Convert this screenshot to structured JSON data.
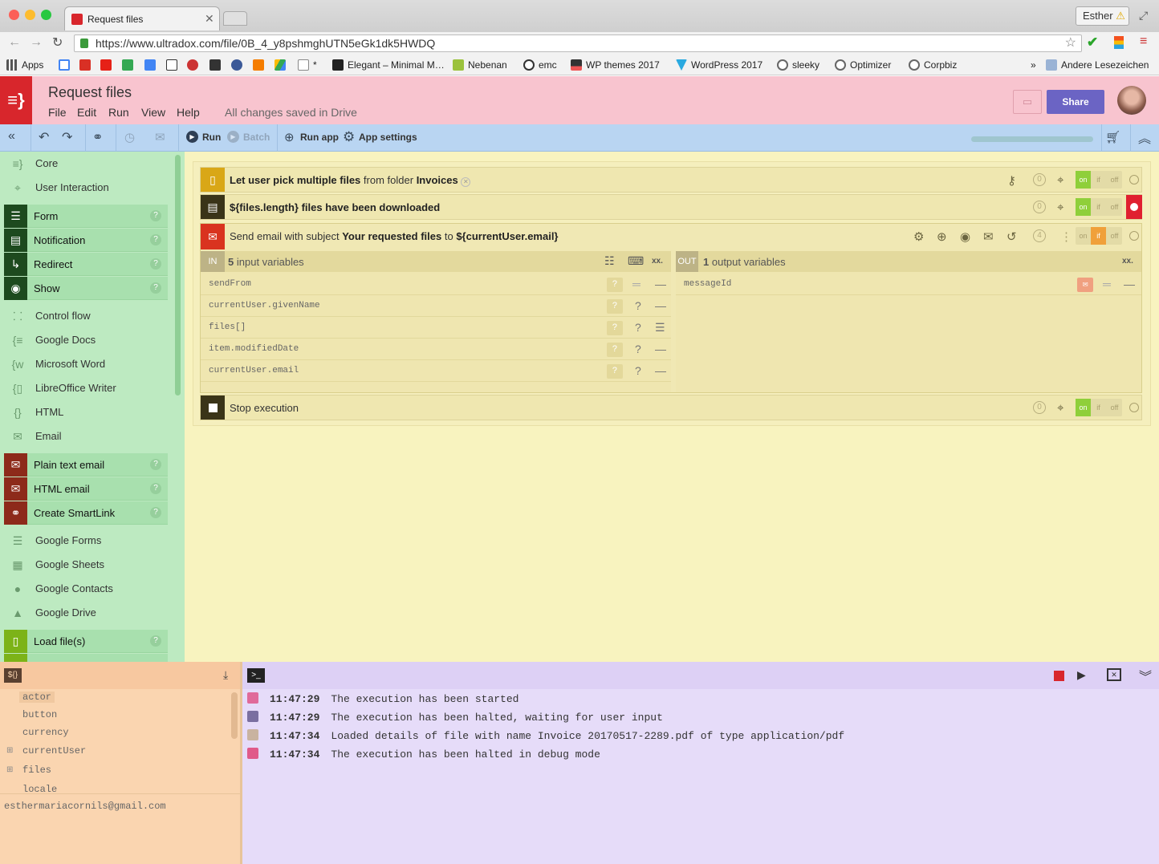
{
  "browser": {
    "tab_title": "Request files",
    "profile_name": "Esther",
    "url": "https://www.ultradox.com/file/0B_4_y8pshmghUTN5eGk1dk5HWDQ",
    "bookmarks": [
      "Apps",
      "*",
      "Elegant – Minimal M…",
      "Nebenan",
      "emc",
      "WP themes 2017",
      "WordPress 2017",
      "sleeky",
      "Optimizer",
      "Corpbiz",
      "»",
      "Andere Lesezeichen"
    ]
  },
  "app": {
    "logo": "≡}",
    "title": "Request files",
    "menu": [
      "File",
      "Edit",
      "Run",
      "View",
      "Help"
    ],
    "status": "All changes saved in Drive",
    "share_label": "Share"
  },
  "toolbar": {
    "run": "Run",
    "batch": "Batch",
    "run_app": "Run app",
    "app_settings": "App settings"
  },
  "sidebar": {
    "categories": {
      "core": "Core",
      "user_interaction": "User Interaction",
      "control_flow": "Control flow",
      "google_docs": "Google Docs",
      "microsoft_word": "Microsoft Word",
      "libreoffice_writer": "LibreOffice Writer",
      "html": "HTML",
      "email": "Email",
      "google_forms": "Google Forms",
      "google_sheets": "Google Sheets",
      "google_contacts": "Google Contacts",
      "google_drive": "Google Drive"
    },
    "items": {
      "form": "Form",
      "notification": "Notification",
      "redirect": "Redirect",
      "show": "Show",
      "plain_text_email": "Plain text email",
      "html_email": "HTML email",
      "create_smartlink": "Create SmartLink",
      "load_files": "Load file(s)"
    },
    "help": "?"
  },
  "statements": {
    "s1": {
      "pre": "Let user pick",
      "bold1": "multiple files",
      "mid": "from folder",
      "bold2": "Invoices",
      "counter": "0"
    },
    "s2": {
      "text": "${files.length} files have been downloaded",
      "counter": "0"
    },
    "s3": {
      "pre": "Send email with subject",
      "bold1": "Your requested files",
      "mid": "to",
      "bold2": "${currentUser.email}",
      "counter": "4"
    },
    "s4": {
      "text": "Stop execution",
      "counter": "0"
    },
    "toggle": {
      "on": "on",
      "if": "if",
      "off": "off"
    }
  },
  "io": {
    "in_tag": "IN",
    "in_count": "5",
    "in_label": "input variables",
    "out_tag": "OUT",
    "out_count": "1",
    "out_label": "output variables",
    "xx": "xx.",
    "inputs": [
      "sendFrom",
      "currentUser.givenName",
      "files[]",
      "item.modifiedDate",
      "currentUser.email"
    ],
    "outputs": [
      "messageId"
    ]
  },
  "variables": {
    "tag": "${}",
    "list": [
      "actor",
      "button",
      "currency",
      "currentUser",
      "files",
      "locale"
    ],
    "value": "esthermariacornils@gmail.com"
  },
  "console": {
    "logs": [
      {
        "time": "11:47:29",
        "message": "The execution has been started"
      },
      {
        "time": "11:47:29",
        "message": "The execution has been halted, waiting for user input"
      },
      {
        "time": "11:47:34",
        "message": "Loaded details of file with name Invoice 20170517-2289.pdf of type application/pdf"
      },
      {
        "time": "11:47:34",
        "message": "The execution has been halted in debug mode"
      }
    ]
  },
  "colors": {
    "brand_red": "#d8262c",
    "share_purple": "#6b64c4",
    "sidebar_green": "#bdeac1",
    "main_yellow": "#f8f3bf",
    "console_lilac": "#e6dcf9",
    "vars_peach": "#fad5b0"
  }
}
